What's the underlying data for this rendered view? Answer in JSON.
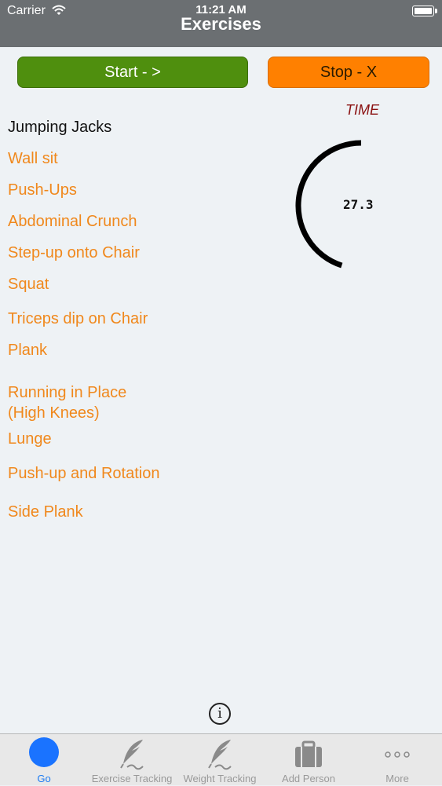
{
  "status_bar": {
    "carrier": "Carrier",
    "time": "11:21 AM"
  },
  "nav": {
    "title": "Exercises"
  },
  "controls": {
    "start_label": "Start - >",
    "stop_label": "Stop - X"
  },
  "exercises": [
    {
      "label": "Jumping Jacks",
      "active": true
    },
    {
      "label": "Wall sit"
    },
    {
      "label": "Push-Ups"
    },
    {
      "label": "Abdominal Crunch"
    },
    {
      "label": "Step-up onto Chair"
    },
    {
      "label": "Squat"
    },
    {
      "label": "Triceps dip on Chair"
    },
    {
      "label": "Plank"
    },
    {
      "label": "Running in Place"
    },
    {
      "label": "(High Knees)"
    },
    {
      "label": "Lunge"
    },
    {
      "label": "Push-up and Rotation"
    },
    {
      "label": "Side Plank"
    }
  ],
  "timer": {
    "label": "TIME",
    "value": "27.3",
    "progress": 0.45
  },
  "info": {
    "symbol": "i"
  },
  "tabs": [
    {
      "label": "Go",
      "icon": "go-circle-icon",
      "selected": true
    },
    {
      "label": "Exercise Tracking",
      "icon": "quill-pen-icon"
    },
    {
      "label": "Weight Tracking",
      "icon": "quill-pen-icon"
    },
    {
      "label": "Add Person",
      "icon": "briefcase-icon"
    },
    {
      "label": "More",
      "icon": "more-dots-icon"
    }
  ],
  "colors": {
    "accent": "#1e7cf2",
    "start": "#4f8f0e",
    "stop": "#ff8000",
    "exercise": "#f0881c",
    "time_label": "#8a1010"
  }
}
